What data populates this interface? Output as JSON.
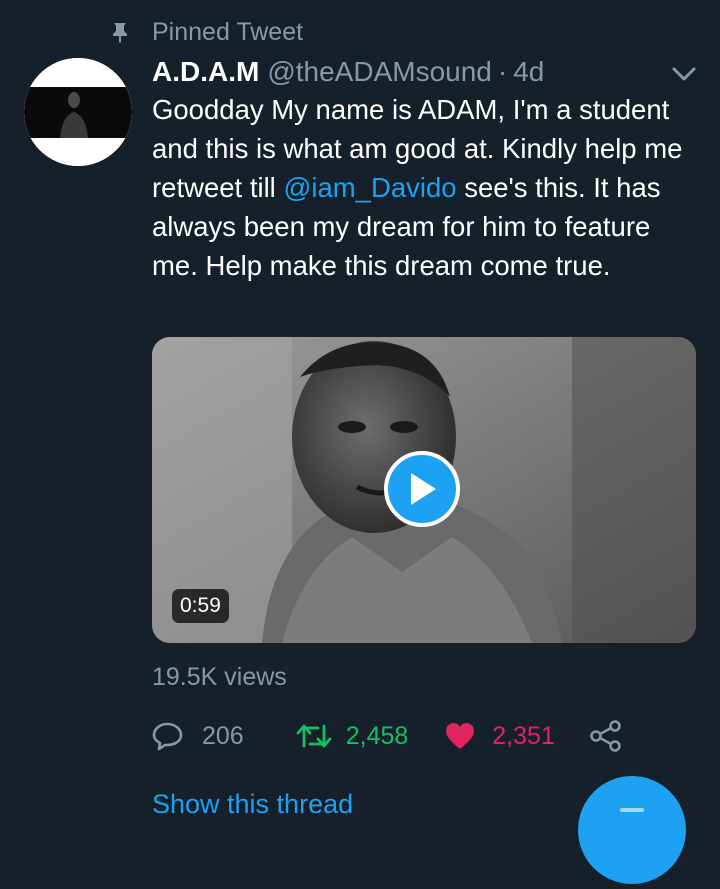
{
  "pinned": {
    "label": "Pinned Tweet",
    "icon": "pin-icon"
  },
  "tweet": {
    "display_name": "A.D.A.M",
    "handle": "@theADAMsound",
    "separator": "·",
    "time": "4d",
    "text_before_mention": "Goodday My name is ADAM, I'm a student and this is what am good at. Kindly help me retweet till ",
    "mention": "@iam_Davido",
    "text_after_mention": " see's this. It has always been my dream for him to feature me. Help make this dream come true.",
    "video": {
      "duration": "0:59"
    },
    "views": "19.5K views",
    "replies": "206",
    "retweets": "2,458",
    "likes": "2,351"
  },
  "footer": {
    "show_thread": "Show this thread"
  },
  "colors": {
    "background": "#15202b",
    "accent": "#1da1f2",
    "muted": "#8899a6",
    "retweet": "#17bf63",
    "like": "#e0245e"
  }
}
